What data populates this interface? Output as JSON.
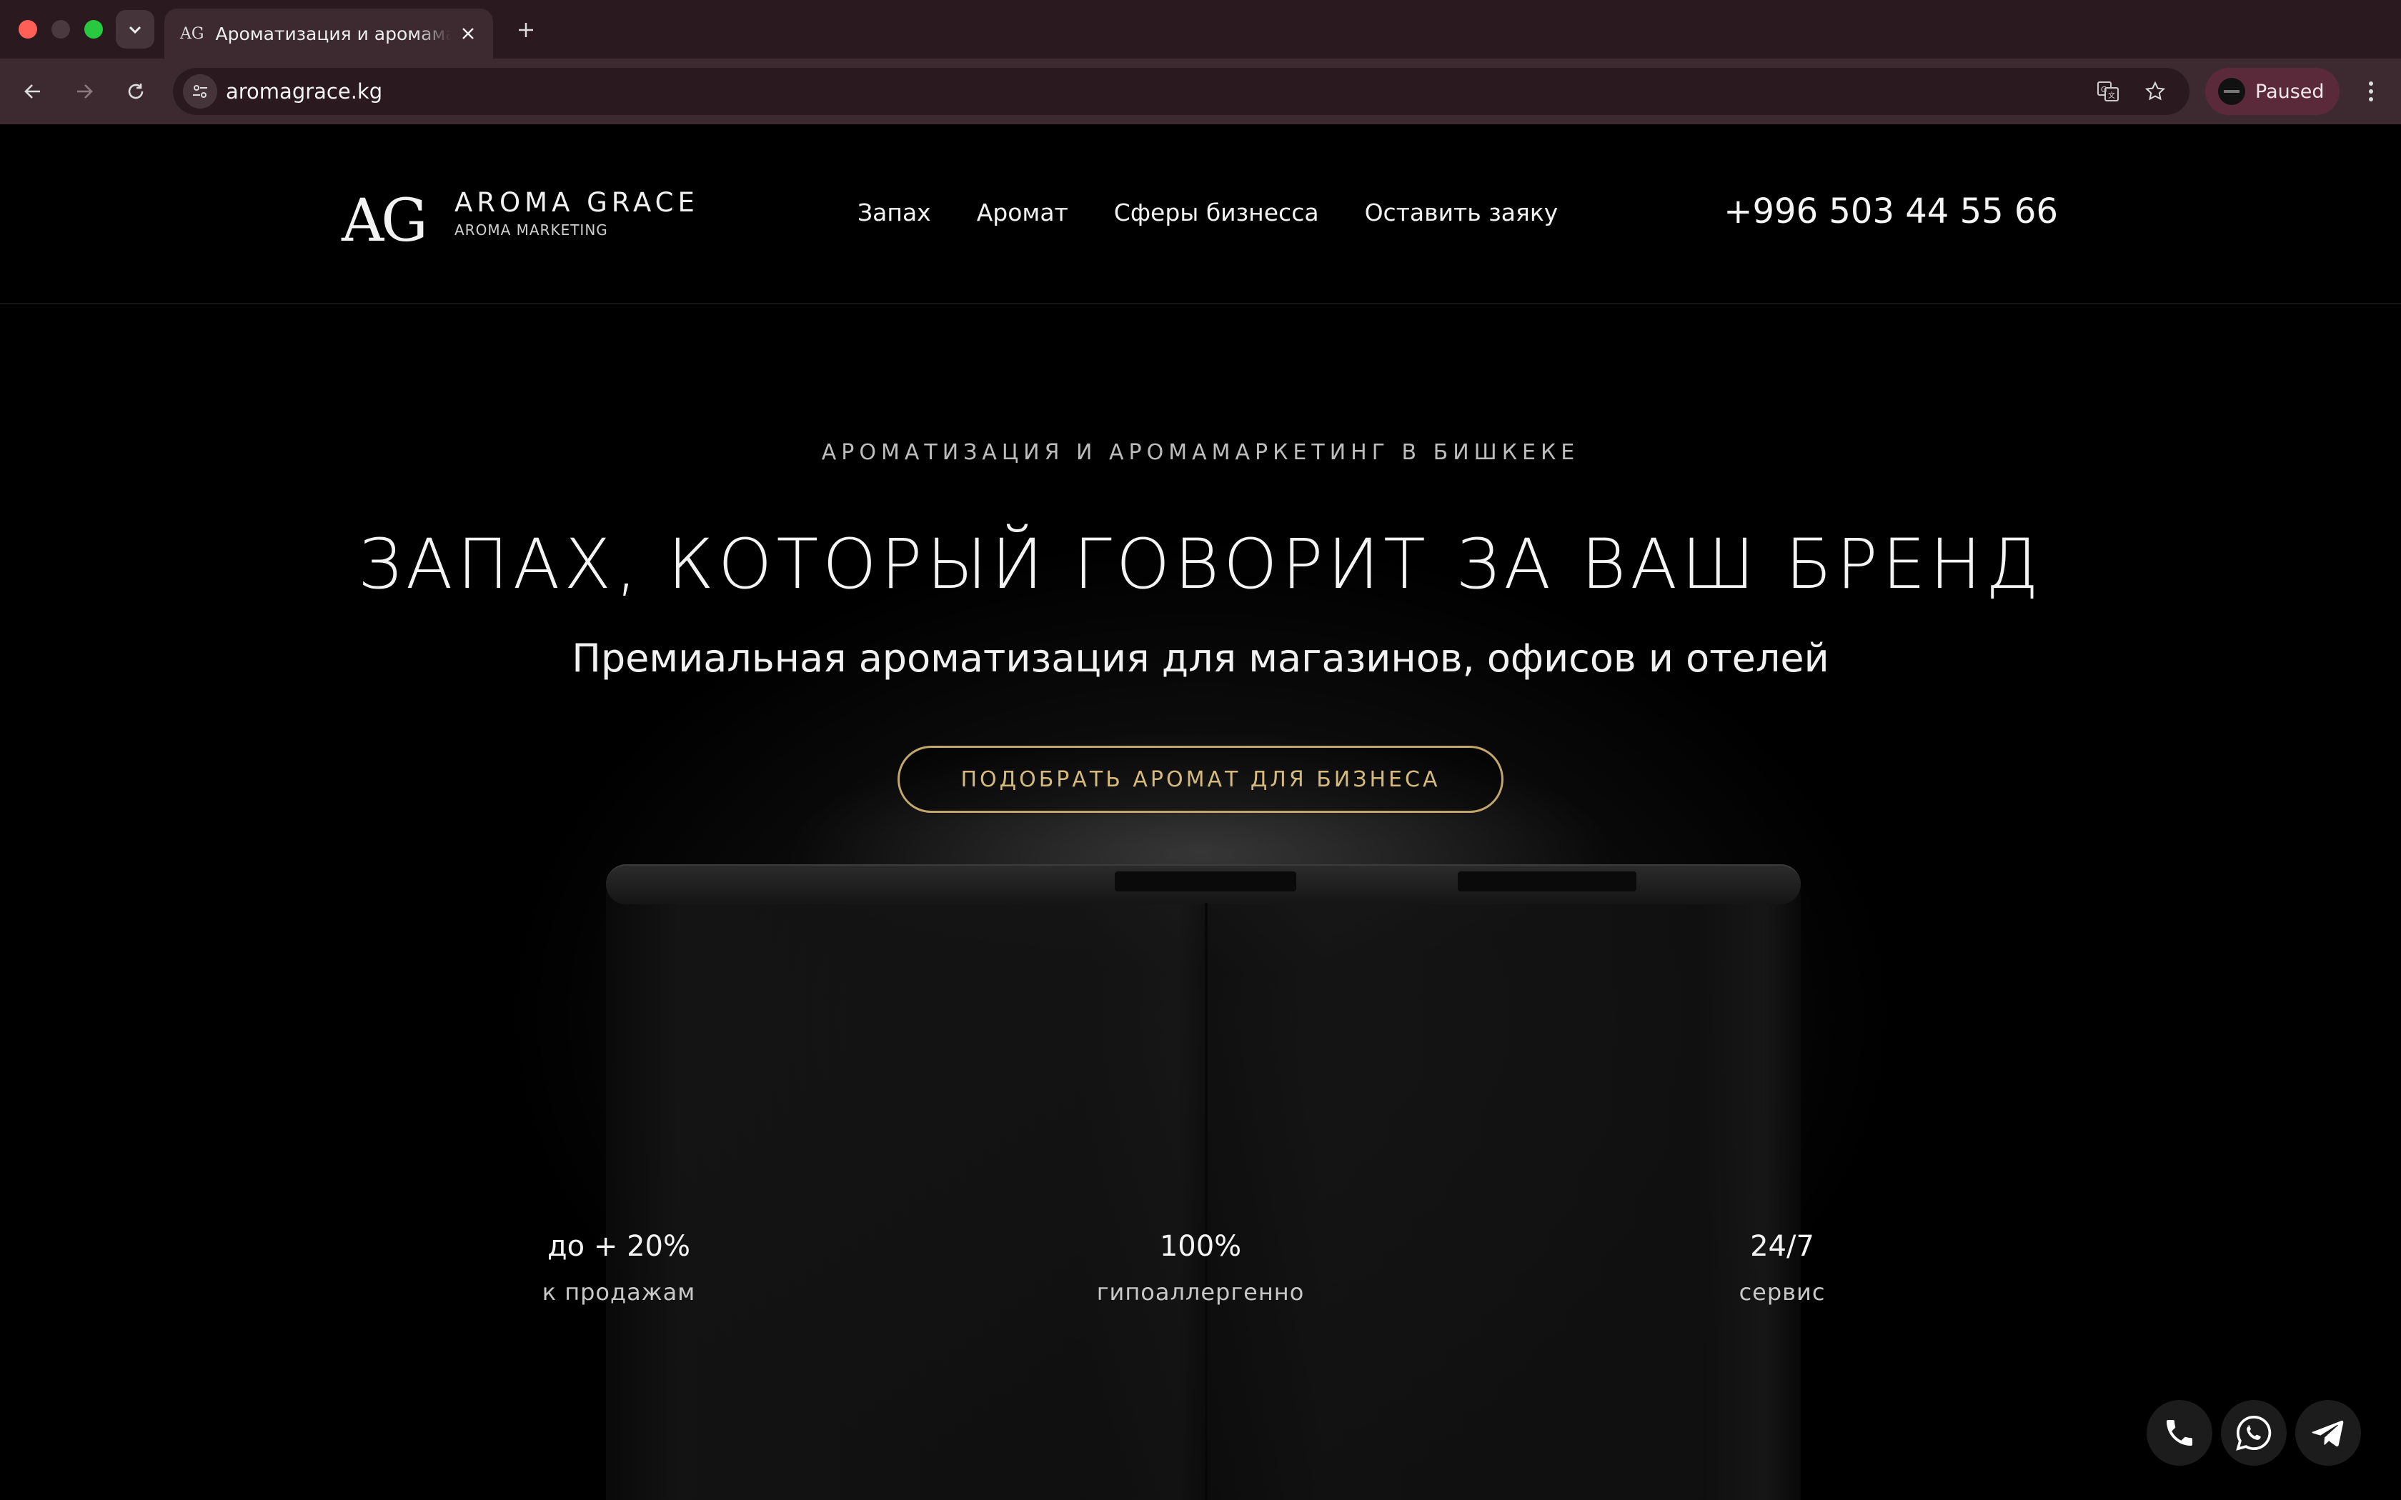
{
  "browser": {
    "tab": {
      "favicon_text": "AG",
      "title": "Ароматизация и аромамаркетинг в Бишкеке"
    },
    "url": "aromagrace.kg",
    "profile_label": "Paused"
  },
  "site": {
    "logo": {
      "mark": "AG",
      "name": "AROMA GRACE",
      "tagline": "AROMA MARKETING"
    },
    "nav": [
      "Запах",
      "Аромат",
      "Сферы бизнесса",
      "Оставить заяку"
    ],
    "phone": "+996 503 44 55 66"
  },
  "hero": {
    "eyebrow": "АРОМАТИЗАЦИЯ И АРОМАМАРКЕТИНГ В БИШКЕКЕ",
    "headline": "ЗАПАХ, КОТОРЫЙ ГОВОРИТ ЗА ВАШ БРЕНД",
    "subheadline": "Премиальная ароматизация для магазинов, офисов и отелей",
    "cta": "ПОДОБРАТЬ АРОМАТ ДЛЯ БИЗНЕСА"
  },
  "stats": [
    {
      "value": "до + 20%",
      "label": "к продажам"
    },
    {
      "value": "100%",
      "label": "гипоаллергенно"
    },
    {
      "value": "24/7",
      "label": "сервис"
    }
  ],
  "floating_contacts": [
    "phone-icon",
    "whatsapp-icon",
    "telegram-icon"
  ],
  "colors": {
    "accent_gold": "#c3a66a",
    "chrome_dark": "#2a1a1f",
    "chrome_toolbar": "#3c2a30"
  }
}
